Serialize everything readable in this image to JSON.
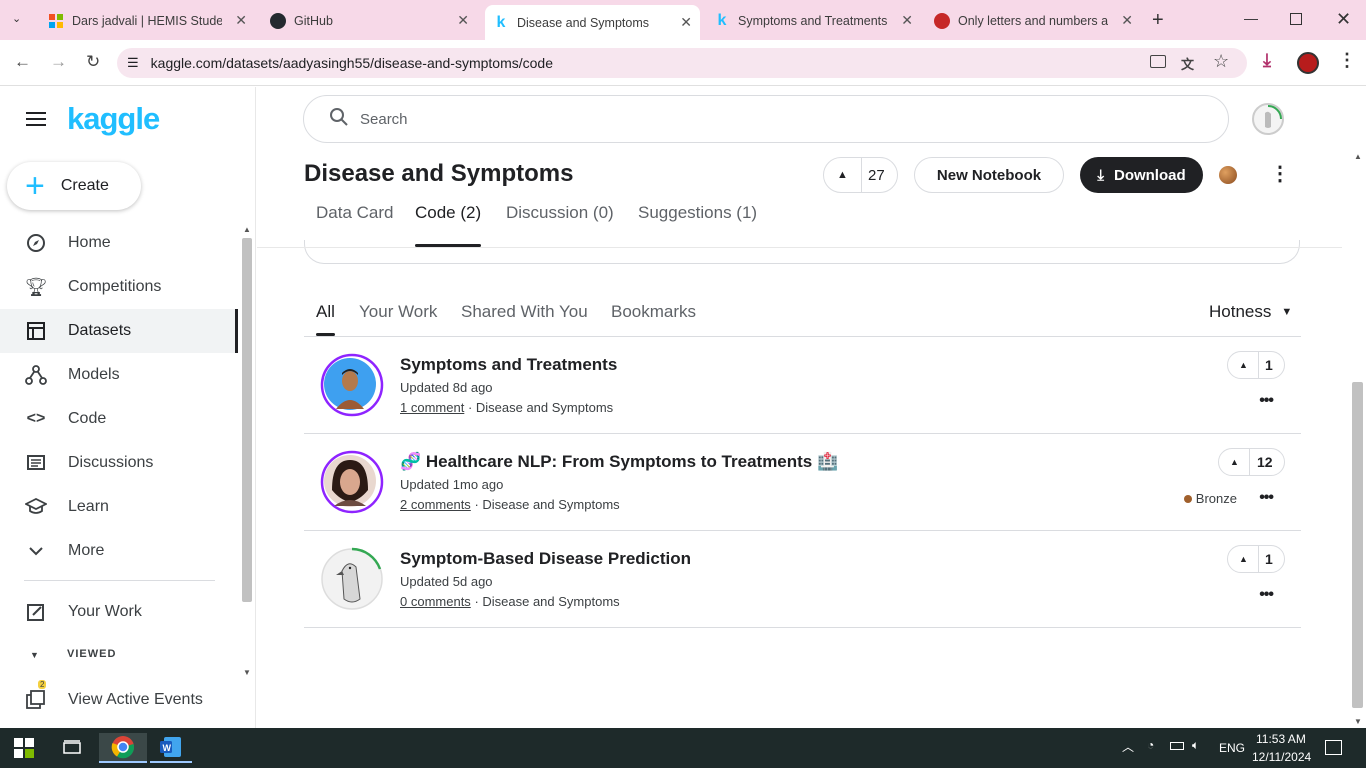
{
  "browser": {
    "tabs": [
      {
        "title": "Dars jadvali | HEMIS Student",
        "icon": "windows-grid-icon"
      },
      {
        "title": "GitHub",
        "icon": "github-icon"
      },
      {
        "title": "Disease and Symptoms",
        "icon": "kaggle-k-icon",
        "active": true
      },
      {
        "title": "Symptoms and Treatments |",
        "icon": "kaggle-k-icon"
      },
      {
        "title": "Only letters and numbers all",
        "icon": "red-circle-icon"
      }
    ],
    "url": "kaggle.com/datasets/aadyasingh55/disease-and-symptoms/code"
  },
  "sidebar": {
    "logo": "kaggle",
    "create_label": "Create",
    "items": [
      {
        "label": "Home",
        "icon": "compass-icon"
      },
      {
        "label": "Competitions",
        "icon": "trophy-icon"
      },
      {
        "label": "Datasets",
        "icon": "table-icon",
        "selected": true
      },
      {
        "label": "Models",
        "icon": "models-icon"
      },
      {
        "label": "Code",
        "icon": "code-icon"
      },
      {
        "label": "Discussions",
        "icon": "discussions-icon"
      },
      {
        "label": "Learn",
        "icon": "learn-icon"
      },
      {
        "label": "More",
        "icon": "chevron-down-icon"
      }
    ],
    "your_work": "Your Work",
    "viewed_label": "VIEWED",
    "active_events": "View Active Events",
    "events_badge": "2"
  },
  "search": {
    "placeholder": "Search"
  },
  "dataset": {
    "title": "Disease and Symptoms",
    "votes": "27",
    "new_notebook": "New Notebook",
    "download": "Download",
    "tabs": [
      "Data Card",
      "Code (2)",
      "Discussion (0)",
      "Suggestions (1)"
    ]
  },
  "filter": {
    "tabs": [
      "All",
      "Your Work",
      "Shared With You",
      "Bookmarks"
    ],
    "sort": "Hotness"
  },
  "notebooks": [
    {
      "title": "Symptoms and Treatments",
      "updated": "Updated 8d ago",
      "comments": "1 comment",
      "source": "· Disease and Symptoms",
      "votes": "1",
      "medal": ""
    },
    {
      "title": "🧬 Healthcare NLP: From Symptoms to Treatments 🏥",
      "updated": "Updated 1mo ago",
      "comments": "2 comments",
      "source": "· Disease and Symptoms",
      "votes": "12",
      "medal": "Bronze"
    },
    {
      "title": "Symptom-Based Disease Prediction",
      "updated": "Updated 5d ago",
      "comments": "0 comments",
      "source": "· Disease and Symptoms",
      "votes": "1",
      "medal": ""
    }
  ],
  "taskbar": {
    "lang": "ENG",
    "time": "11:53 AM",
    "date": "12/11/2024"
  },
  "colors": {
    "kaggle_blue": "#20beff",
    "dark": "#202124",
    "tab_bg": "#f7d9e8"
  }
}
